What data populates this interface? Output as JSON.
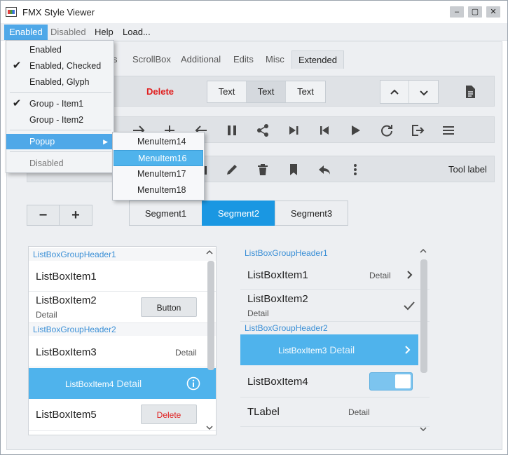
{
  "window": {
    "title": "FMX Style Viewer",
    "buttons": [
      "‒",
      "▢",
      "✕"
    ]
  },
  "menubar": [
    {
      "label": "Enabled",
      "state": "active"
    },
    {
      "label": "Disabled",
      "state": "disabled"
    },
    {
      "label": "Help",
      "state": "normal"
    },
    {
      "label": "Load...",
      "state": "normal"
    }
  ],
  "dropdown": {
    "items": [
      {
        "label": "Enabled",
        "checked": false
      },
      {
        "label": "Enabled, Checked",
        "checked": true
      },
      {
        "label": "Enabled, Glyph",
        "checked": false
      },
      {
        "label": "Group - Item1",
        "checked": true
      },
      {
        "label": "Group - Item2",
        "checked": false
      },
      {
        "label": "Popup",
        "highlighted": true,
        "submenu_arrow": "▶"
      },
      {
        "label": "Disabled",
        "disabled": true
      }
    ],
    "check_glyph": "✔"
  },
  "submenu": {
    "items": [
      "MenuItem14",
      "MenuItem16",
      "MenuItem17",
      "MenuItem18"
    ],
    "highlighted": "MenuItem16"
  },
  "tabs": [
    {
      "label": "s",
      "active": false
    },
    {
      "label": "ScrollBox",
      "active": false
    },
    {
      "label": "Additional",
      "active": false
    },
    {
      "label": "Edits",
      "active": false
    },
    {
      "label": "Misc",
      "active": false
    },
    {
      "label": "Extended",
      "active": true
    }
  ],
  "row1": {
    "delete_label": "Delete",
    "segment_labels": [
      "Text",
      "Text",
      "Text"
    ],
    "segment_selected": 1,
    "icons": [
      "chevron-up-icon",
      "chevron-down-icon",
      "document-icon"
    ]
  },
  "row2": {
    "icons": [
      "arrow-right-icon",
      "plus-icon",
      "arrow-left-icon",
      "pause-icon",
      "share-icon",
      "skip-next-icon",
      "skip-previous-icon",
      "play-icon",
      "refresh-icon",
      "exit-icon",
      "menu-icon"
    ]
  },
  "row3": {
    "icons": [
      "camera-icon",
      "edit-icon",
      "trash-icon",
      "bookmark-icon",
      "reply-icon",
      "more-vertical-icon"
    ],
    "tool_label": "Tool label"
  },
  "stepper": {
    "minus": "−",
    "plus": "+"
  },
  "segments": {
    "labels": [
      "Segment1",
      "Segment2",
      "Segment3"
    ],
    "selected": 1
  },
  "listbox_left": {
    "header1": "ListBoxGroupHeader1",
    "header2": "ListBoxGroupHeader2",
    "item1": "ListBoxItem1",
    "item2": "ListBoxItem2",
    "item2_sub": "Detail",
    "item2_button": "Button",
    "item3": "ListBoxItem3",
    "item3_detail": "Detail",
    "item4": "ListBoxItem4",
    "item4_detail": "Detail",
    "item5": "ListBoxItem5",
    "item5_button": "Delete"
  },
  "listbox_right": {
    "header1": "ListBoxGroupHeader1",
    "header2": "ListBoxGroupHeader2",
    "item1": "ListBoxItem1",
    "item1_detail": "Detail",
    "item2": "ListBoxItem2",
    "item2_sub": "Detail",
    "item3": "ListBoxItem3",
    "item3_detail": "Detail",
    "item4": "ListBoxItem4",
    "item4_toggle_on": true,
    "item5": "TLabel",
    "item5_detail": "Detail"
  },
  "colors": {
    "accent": "#1a97e2",
    "selection": "#4fb3ec",
    "menu_highlight": "#4fa8e8",
    "danger": "#e02020",
    "header_text": "#3a8fd6"
  }
}
